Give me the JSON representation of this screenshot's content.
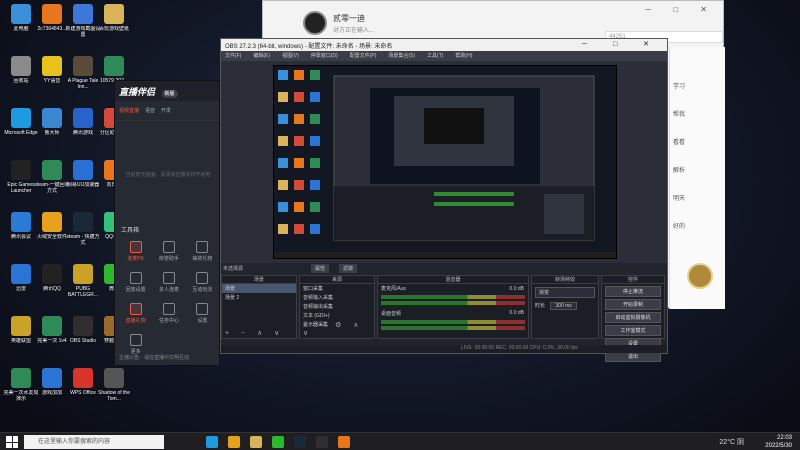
{
  "desktop": {
    "icons": [
      {
        "label": "此电脑",
        "color": "#3b8fd8"
      },
      {
        "label": "2c7364843...",
        "color": "#e8761c"
      },
      {
        "label": "新建游戏截图设置",
        "color": "#3c78d8"
      },
      {
        "label": "百玩游戏壁纸",
        "color": "#d9b35a"
      },
      {
        "label": "回收站",
        "color": "#8a8a8a"
      },
      {
        "label": "YY语音",
        "color": "#e8c21c"
      },
      {
        "label": "A Plague Tale Inn...",
        "color": "#5a4a3a"
      },
      {
        "label": "10579-202...",
        "color": "#2e8b57"
      },
      {
        "label": "Microsoft Edge",
        "color": "#1e9be0"
      },
      {
        "label": "鲁大师",
        "color": "#3a86d0"
      },
      {
        "label": "腾讯游戏",
        "color": "#2962c9"
      },
      {
        "label": "分区助手 9.6",
        "color": "#d44a3a"
      },
      {
        "label": "Epic Games Launcher",
        "color": "#222222"
      },
      {
        "label": "steam-一键回收方式",
        "color": "#2e8b57"
      },
      {
        "label": "网易UU加速器",
        "color": "#2a6fd6"
      },
      {
        "label": "向日葵",
        "color": "#e8761c"
      },
      {
        "label": "腾讯会议",
        "color": "#2a7ad6"
      },
      {
        "label": "火绒安全软件",
        "color": "#e8a11c"
      },
      {
        "label": "steam - 快捷方式",
        "color": "#1b2838"
      },
      {
        "label": "QQ音乐",
        "color": "#31c27c"
      },
      {
        "label": "迅雷",
        "color": "#2a74d6"
      },
      {
        "label": "腾讯QQ",
        "color": "#222222"
      },
      {
        "label": "PUBG BATTLEGR...",
        "color": "#c9a227"
      },
      {
        "label": "微信",
        "color": "#2eb82e"
      },
      {
        "label": "英雄联盟",
        "color": "#c9a227"
      },
      {
        "label": "完美一次 1v4",
        "color": "#2e8b57"
      },
      {
        "label": "OBS Studio",
        "color": "#302e31"
      },
      {
        "label": "穿越火线",
        "color": "#9a6a2a"
      },
      {
        "label": "完美一次水友局演示",
        "color": "#2e8b57"
      },
      {
        "label": "游戏加加",
        "color": "#2a74d6"
      },
      {
        "label": "WPS Office",
        "color": "#d9342b"
      },
      {
        "label": "Shadow of the Tom...",
        "color": "#555555"
      }
    ]
  },
  "chat": {
    "name": "贰零一迪",
    "status": "对方正在输入...",
    "search": "44251",
    "side_texts": [
      "学习",
      "帮我",
      "看看",
      "解析",
      "明天",
      "好的"
    ]
  },
  "live": {
    "logo": "直播伴侣",
    "badge": "新版",
    "tabs": [
      "视频直播",
      "语音",
      "开发"
    ],
    "empty_text": "当前暂无画面，请添加直播素材开始吧",
    "tools_title": "工具箱",
    "tools": [
      "连麦PK",
      "房管助手",
      "抽奖礼物",
      "回放设置",
      "多人连麦",
      "互动玩法",
      "直播礼物",
      "任务中心",
      "设置",
      "更多"
    ],
    "footer": "主播公告：请在直播中文明互动"
  },
  "obs": {
    "title": "OBS 27.2.3 (64-bit, windows) - 配置文件: 未命名 - 场景: 未命名",
    "menu": [
      "文件(F)",
      "编辑(E)",
      "视图(V)",
      "停靠窗口(D)",
      "配置文件(P)",
      "场景集合(S)",
      "工具(T)",
      "帮助(H)"
    ],
    "no_source": "未选择源",
    "props_btn": "属性",
    "filter_btn": "滤镜",
    "scenes_header": "场景",
    "scenes": [
      "场景",
      "场景 2"
    ],
    "sources_header": "来源",
    "sources": [
      "窗口采集",
      "音频输入采集",
      "音频输出采集",
      "文本 (GDI+)",
      "显示器采集"
    ],
    "mixer_header": "混音器",
    "mixer": [
      {
        "name": "麦克风/Aux",
        "db": "0.0 dB"
      },
      {
        "name": "桌面音频",
        "db": "0.0 dB"
      }
    ],
    "transitions_header": "转场特效",
    "transition": "渐变",
    "duration_label": "时长",
    "duration": "300 ms",
    "controls_header": "控件",
    "controls": [
      "停止推流",
      "开始录制",
      "启动虚拟摄像机",
      "工作室模式",
      "设置",
      "退出"
    ],
    "status": "LIVE: 00:00:00   REC: 00:00:00   CPU: 0.3%, 30.00 fps"
  },
  "taskbar": {
    "search_placeholder": "在这里输入你要搜索的内容",
    "weather": "22°C 阴",
    "time": "22:03",
    "date": "2022/5/30",
    "app_colors": [
      "#1e9be0",
      "#e8a11c",
      "#d9b35a",
      "#2eb82e",
      "#1b2838",
      "#302e31",
      "#e8761c"
    ]
  }
}
